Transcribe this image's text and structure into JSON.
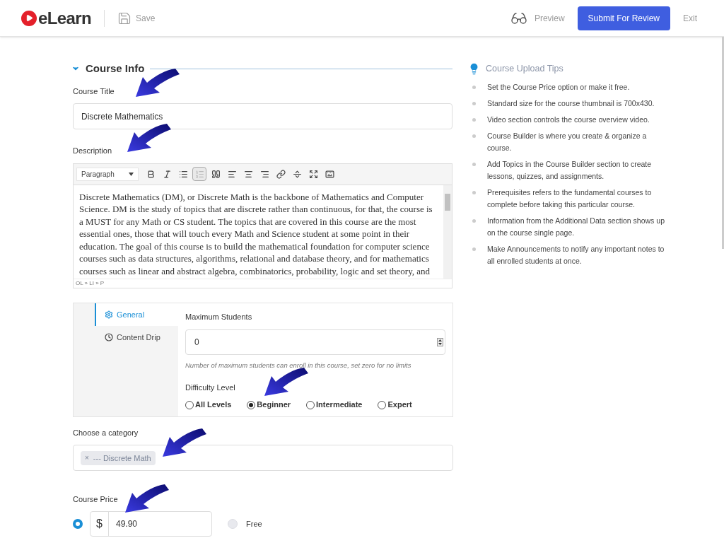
{
  "header": {
    "logo": "eLearn",
    "save": "Save",
    "preview": "Preview",
    "submit": "Submit For Review",
    "exit": "Exit"
  },
  "section": {
    "title": "Course Info",
    "expanded": true
  },
  "course_title": {
    "label": "Course Title",
    "value": "Discrete Mathematics"
  },
  "description": {
    "label": "Description",
    "format": "Paragraph",
    "toolbar": [
      {
        "kind": "bold",
        "active": false
      },
      {
        "kind": "italic",
        "active": false
      },
      {
        "kind": "bullets",
        "active": false
      },
      {
        "kind": "numbers",
        "active": true
      },
      {
        "kind": "quote",
        "active": false
      },
      {
        "kind": "left",
        "active": false
      },
      {
        "kind": "center",
        "active": false
      },
      {
        "kind": "right",
        "active": false
      },
      {
        "kind": "link",
        "active": false
      },
      {
        "kind": "more",
        "active": false
      },
      {
        "kind": "fullscreen",
        "active": false
      },
      {
        "kind": "keyboard",
        "active": false
      }
    ],
    "text": "Discrete Mathematics (DM), or Discrete Math is the backbone of Mathematics and Computer Science. DM is the study of topics that are discrete rather than continuous, for that, the course is a MUST for any Math or CS student. The topics that are covered in this course are the most essential ones, those that will touch every Math and Science student at some point in their education. The goal of this course is to build the mathematical foundation for computer science courses such as data structures, algorithms, relational and database theory, and for mathematics courses such as linear and abstract algebra, combinatorics, probability, logic and set theory, and",
    "path": "OL » LI » P"
  },
  "settings": {
    "tabs": [
      {
        "label": "General",
        "kind": "gear",
        "selected": true
      },
      {
        "label": "Content Drip",
        "kind": "clock",
        "selected": false
      }
    ],
    "max_students": {
      "label": "Maximum Students",
      "value": "0",
      "hint": "Number of maximum students can enroll in this course, set zero for no limits"
    },
    "difficulty": {
      "label": "Difficulty Level",
      "options": [
        {
          "label": "All Levels",
          "selected": false
        },
        {
          "label": "Beginner",
          "selected": true
        },
        {
          "label": "Intermediate",
          "selected": false
        },
        {
          "label": "Expert",
          "selected": false
        }
      ]
    }
  },
  "category": {
    "label": "Choose a category",
    "tags": [
      {
        "remove": "×",
        "label": "--- Discrete Math"
      }
    ]
  },
  "price": {
    "label": "Course Price",
    "options": [
      {
        "kind": "amount",
        "currency": "$",
        "value": "49.90",
        "selected": true
      },
      {
        "kind": "free",
        "label": "Free",
        "selected": false
      }
    ]
  },
  "tips": {
    "title": "Course Upload Tips",
    "items": [
      "Set the Course Price option or make it free.",
      "Standard size for the course thumbnail is 700x430.",
      "Video section controls the course overview video.",
      "Course Builder is where you create & organize a course.",
      "Add Topics in the Course Builder section to create lessons, quizzes, and assignments.",
      "Prerequisites refers to the fundamental courses to complete before taking this particular course.",
      "Information from the Additional Data section shows up on the course single page.",
      "Make Announcements to notify any important notes to all enrolled students at once."
    ]
  }
}
